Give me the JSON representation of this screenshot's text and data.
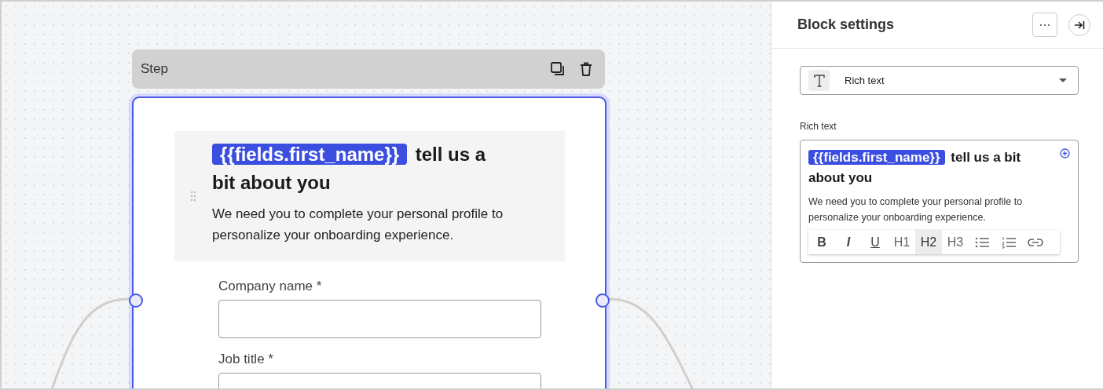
{
  "step": {
    "title": "Step",
    "selected": true,
    "heading": {
      "tag": "{{fields.first_name}}",
      "text": "tell us a bit about you"
    },
    "body": "We need you to complete your personal profile to personalize your onboarding experience.",
    "fields": [
      {
        "label": "Company name *"
      },
      {
        "label": "Job title *"
      }
    ]
  },
  "panel": {
    "title": "Block settings",
    "block_type": "Rich text",
    "field_label": "Rich text",
    "editor": {
      "tag": "{{fields.first_name}}",
      "text": "tell us a bit about you",
      "body": "We need you to complete your personal profile to personalize your onboarding experience."
    },
    "toolbar": [
      {
        "kind": "bold",
        "label": "B",
        "selected": false
      },
      {
        "kind": "italic",
        "label": "I",
        "selected": false
      },
      {
        "kind": "underline",
        "label": "U",
        "selected": false
      },
      {
        "kind": "heading",
        "label": "H1",
        "selected": false
      },
      {
        "kind": "heading",
        "label": "H2",
        "selected": true
      },
      {
        "kind": "heading",
        "label": "H3",
        "selected": false
      },
      {
        "kind": "bullet-list",
        "selected": false
      },
      {
        "kind": "numbered-list",
        "selected": false
      },
      {
        "kind": "link",
        "selected": false
      }
    ]
  }
}
